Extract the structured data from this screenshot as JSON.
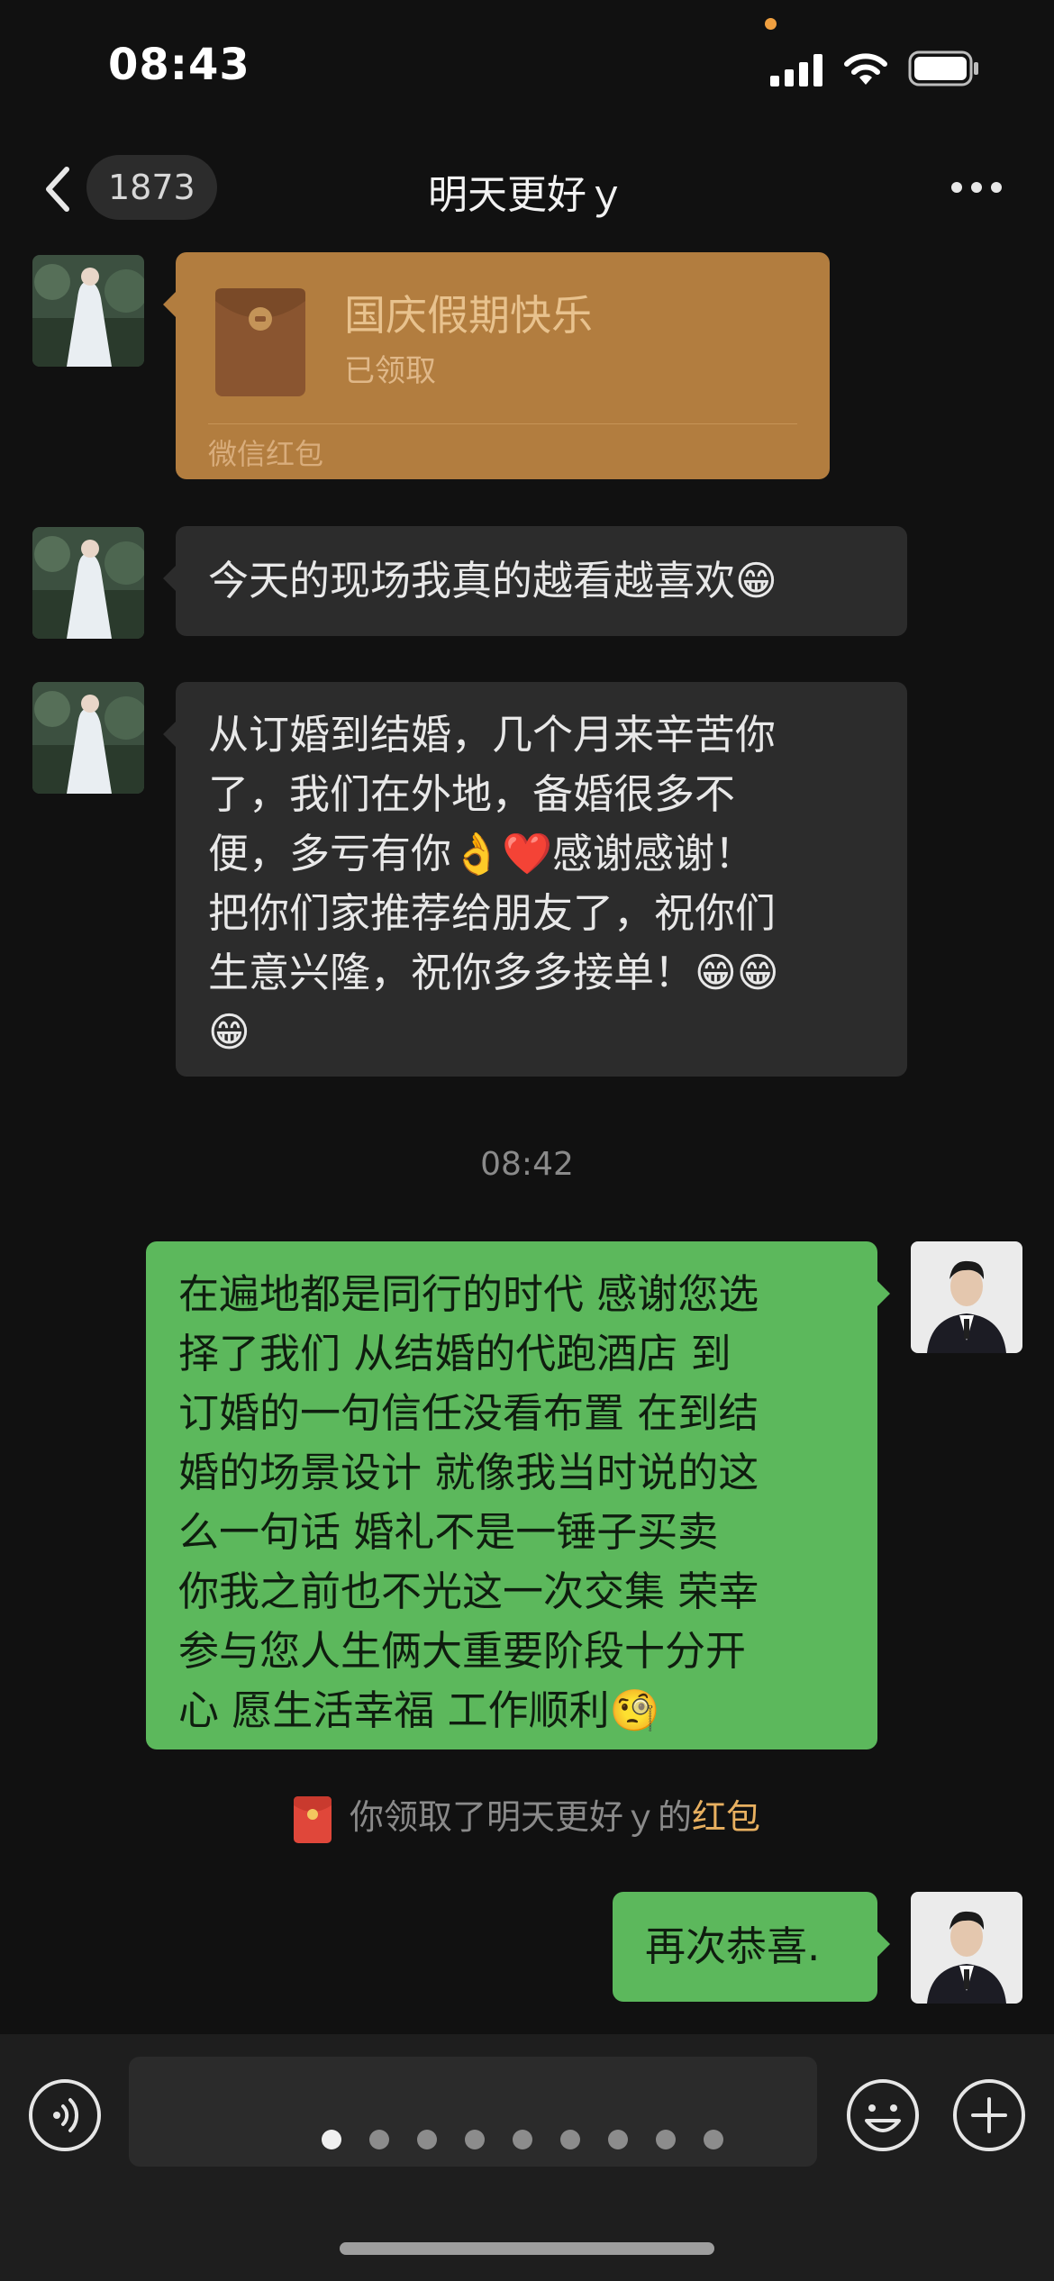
{
  "status_bar": {
    "time": "08:43"
  },
  "nav": {
    "unread_count": "1873",
    "title": "明天更好ｙ"
  },
  "red_packet": {
    "greeting": "国庆假期快乐",
    "status": "已领取",
    "footer": "微信红包"
  },
  "messages": [
    {
      "from": "them",
      "text": "今天的现场我真的越看越喜欢😁"
    },
    {
      "from": "them",
      "lines": [
        "从订婚到结婚，几个月来辛苦你",
        "了，我们在外地，备婚很多不",
        "便，多亏有你👌❤️感谢感谢！",
        "把你们家推荐给朋友了，祝你们",
        "生意兴隆，祝你多多接单！😁😁",
        "😁"
      ]
    },
    {
      "from": "me",
      "lines": [
        "在遍地都是同行的时代 感谢您选",
        "择了我们 从结婚的代跑酒店 到",
        "订婚的一句信任没看布置 在到结",
        "婚的场景设计 就像我当时说的这",
        "么一句话 婚礼不是一锤子买卖",
        "你我之前也不光这一次交集 荣幸",
        "参与您人生俩大重要阶段十分开",
        "心 愿生活幸福 工作顺利🧐"
      ]
    },
    {
      "from": "me",
      "text": "再次恭喜."
    }
  ],
  "timestamp": "08:42",
  "system_note": {
    "prefix": "你领取了明天更好ｙ的",
    "highlight": "红包"
  },
  "input_bar": {
    "page_count": 9,
    "active_page": 1
  },
  "colors": {
    "background": "#111111",
    "incoming_bubble": "#2c2c2c",
    "outgoing_bubble": "#5cb85c",
    "red_packet": "#b27d3f",
    "highlight": "#e8b060"
  }
}
